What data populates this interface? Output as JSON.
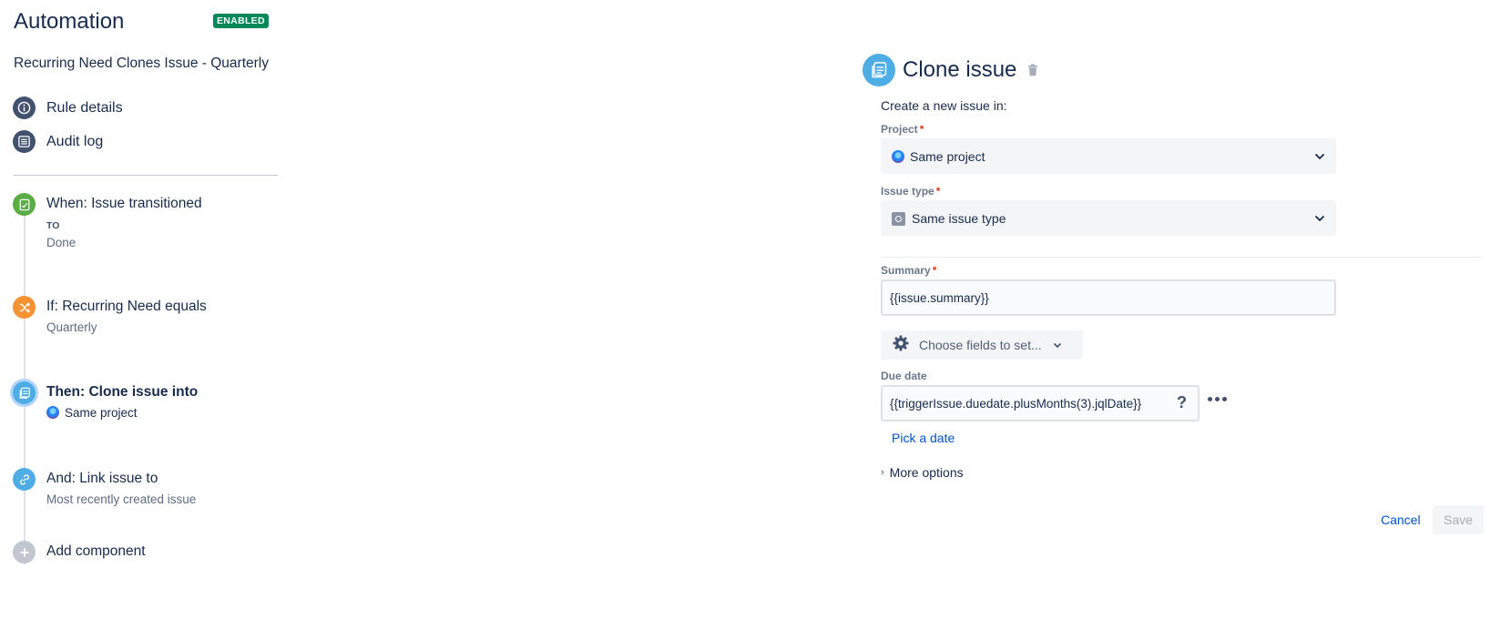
{
  "header": {
    "title": "Automation",
    "status_badge": "ENABLED",
    "rule_name": "Recurring Need Clones Issue - Quarterly"
  },
  "sidebar": {
    "links": [
      {
        "label": "Rule details",
        "icon": "info-icon"
      },
      {
        "label": "Audit log",
        "icon": "list-icon"
      }
    ],
    "steps": [
      {
        "title": "When: Issue transitioned",
        "tag": "TO",
        "subtitle": "Done",
        "icon": "trigger-icon",
        "color": "#5aac44"
      },
      {
        "title": "If: Recurring Need equals",
        "subtitle": "Quarterly",
        "icon": "shuffle-icon",
        "color": "#f79232"
      },
      {
        "title": "Then: Clone issue into",
        "subtitle": "Same project",
        "icon": "clone-icon",
        "color": "#4fade6",
        "selected": true
      },
      {
        "title": "And: Link issue to",
        "subtitle": "Most recently created issue",
        "icon": "link-icon",
        "color": "#4fade6"
      },
      {
        "title": "Add component",
        "icon": "plus-icon",
        "color": "#c1c7d0"
      }
    ]
  },
  "editor": {
    "title": "Clone issue",
    "intro": "Create a new issue in:",
    "project": {
      "label": "Project",
      "required": "*",
      "value": "Same project"
    },
    "issue_type": {
      "label": "Issue type",
      "required": "*",
      "value": "Same issue type"
    },
    "summary": {
      "label": "Summary",
      "required": "*",
      "value": "{{issue.summary}}"
    },
    "choose_fields_label": "Choose fields to set...",
    "due_date": {
      "label": "Due date",
      "value": "{{triggerIssue.duedate.plusMonths(3).jqlDate}}",
      "help": "?"
    },
    "pick_date_label": "Pick a date",
    "more_options_label": "More options",
    "cancel_label": "Cancel",
    "save_label": "Save"
  },
  "colors": {
    "primary_text": "#172b4d",
    "link": "#0052cc",
    "badge_green": "#00875a",
    "required_red": "#de350b"
  }
}
